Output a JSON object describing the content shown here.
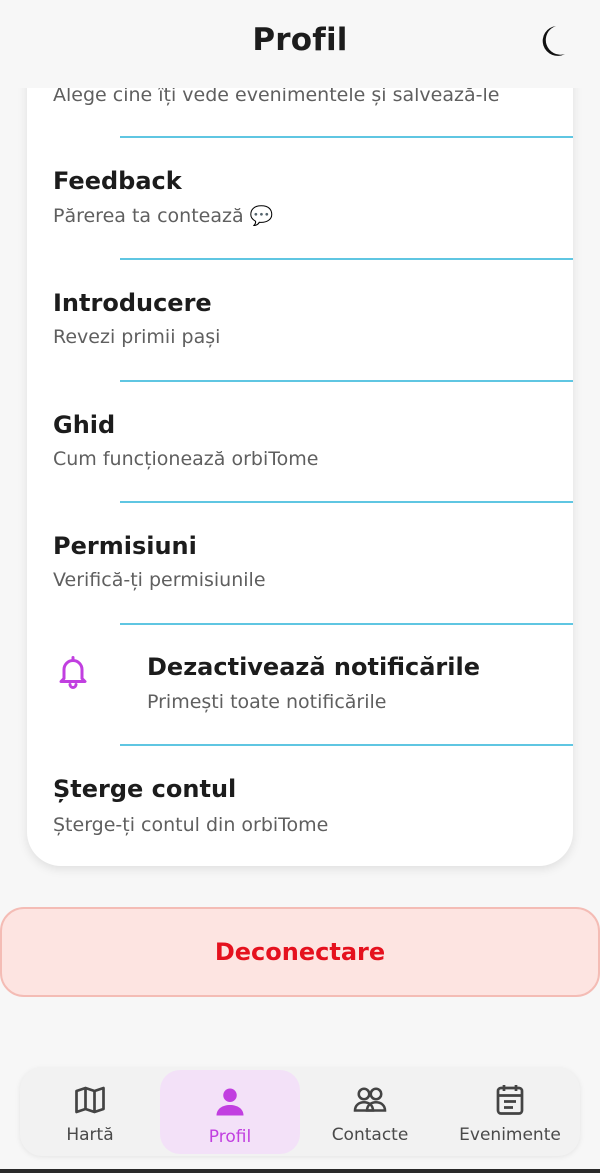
{
  "header": {
    "title": "Profil",
    "theme_icon": "moon-icon"
  },
  "settings": {
    "partial_item": {
      "subtitle": "Alege cine îți vede evenimentele și salvează-le"
    },
    "items": [
      {
        "title": "Feedback",
        "subtitle": "Părerea ta contează 💬"
      },
      {
        "title": "Introducere",
        "subtitle": "Revezi primii pași"
      },
      {
        "title": "Ghid",
        "subtitle": "Cum funcționează orbiTome"
      },
      {
        "title": "Permisiuni",
        "subtitle": "Verifică-ți permisiunile"
      },
      {
        "title": "Dezactivează notificările",
        "subtitle": "Primești toate notificările",
        "icon": "bell-icon"
      },
      {
        "title": "Șterge contul",
        "subtitle": "Șterge-ți contul din orbiTome"
      }
    ]
  },
  "logout": {
    "label": "Deconectare"
  },
  "tabbar": {
    "tabs": [
      {
        "label": "Hartă",
        "icon": "map-icon",
        "active": false
      },
      {
        "label": "Profil",
        "icon": "user-icon",
        "active": true
      },
      {
        "label": "Contacte",
        "icon": "contacts-icon",
        "active": false
      },
      {
        "label": "Evenimente",
        "icon": "calendar-icon",
        "active": false
      }
    ]
  },
  "colors": {
    "accent": "#c13fe0",
    "divider": "#5fc6e2",
    "logout_text": "#e5111e",
    "logout_bg": "#fde4e1"
  }
}
